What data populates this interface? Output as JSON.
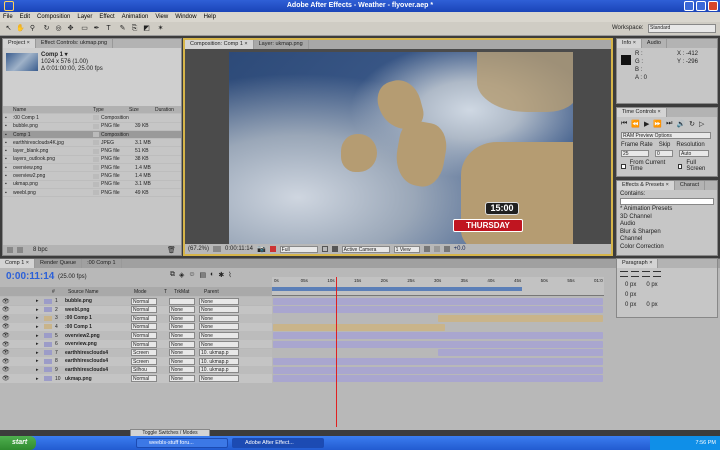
{
  "window": {
    "title": "Adobe After Effects - Weather - flyover.aep *"
  },
  "menu": [
    "File",
    "Edit",
    "Composition",
    "Layer",
    "Effect",
    "Animation",
    "View",
    "Window",
    "Help"
  ],
  "workspace": {
    "label": "Workspace:",
    "value": "Standard"
  },
  "project": {
    "tabs": [
      "Project ×",
      "Effect Controls: ukmap.png"
    ],
    "info_name": "Comp 1 ▾",
    "info_size": "1024 x 576 (1.00)",
    "info_dur": "Δ 0:01:00:00, 25.00 fps",
    "columns": [
      "Name",
      "Type",
      "Size",
      "Duration"
    ],
    "items": [
      {
        "name": ":00 Comp 1",
        "type": "Composition",
        "size": ""
      },
      {
        "name": "bubble.png",
        "type": "PNG file",
        "size": "39 KB"
      },
      {
        "name": "Comp 1",
        "type": "Composition",
        "size": ""
      },
      {
        "name": "earthhiresclouds4K.jpg",
        "type": "JPEG",
        "size": "3.1 MB"
      },
      {
        "name": "layer_blank.png",
        "type": "PNG file",
        "size": "51 KB"
      },
      {
        "name": "layers_outlook.png",
        "type": "PNG file",
        "size": "38 KB"
      },
      {
        "name": "overview.png",
        "type": "PNG file",
        "size": "1.4 MB"
      },
      {
        "name": "overview2.png",
        "type": "PNG file",
        "size": "1.4 MB"
      },
      {
        "name": "ukmap.png",
        "type": "PNG file",
        "size": "3.1 MB"
      },
      {
        "name": "weebl.png",
        "type": "PNG file",
        "size": "49 KB"
      }
    ],
    "bpc": "8 bpc"
  },
  "viewer": {
    "tabs": [
      "Composition: Comp 1 ×",
      "Layer: ukmap.png"
    ],
    "time_text": "15:00",
    "day_text": "THURSDAY",
    "zoom": "(67.2%)",
    "timecode": "0:00:11:14",
    "resolution": "Full",
    "camera": "Active Camera",
    "views": "1 View",
    "offset": "+0.0"
  },
  "info": {
    "tabs": [
      "Info ×",
      "Audio"
    ],
    "r": "R :",
    "g": "G :",
    "b": "B :",
    "a": "A : 0",
    "x": "X : -412",
    "y": "Y : -296"
  },
  "time_controls": {
    "tab": "Time Controls ×",
    "ram": "RAM Preview Options",
    "frame_rate_label": "Frame Rate",
    "skip_label": "Skip",
    "res_label": "Resolution",
    "frame_rate": "25",
    "skip": "0",
    "res": "Auto",
    "from_current": "From Current Time",
    "full_screen": "Full Screen"
  },
  "effects": {
    "tabs": [
      "Effects & Presets ×",
      "Charact"
    ],
    "contains": "Contains:",
    "items": [
      "* Animation Presets",
      "3D Channel",
      "Audio",
      "Blur & Sharpen",
      "Channel",
      "Color Correction"
    ]
  },
  "paragraph": {
    "tab": "Paragraph ×",
    "px1": "0 px",
    "px2": "0 px",
    "px3": "0 px",
    "px4": "0 px",
    "px5": "0 px"
  },
  "timeline": {
    "tabs": [
      "Comp 1 ×",
      "Render Queue",
      ":00 Comp 1"
    ],
    "timecode": "0:00:11:14",
    "fps": "(25.00 fps)",
    "columns": [
      "#",
      "Source Name",
      "Mode",
      "T",
      "TrkMat",
      "Parent"
    ],
    "ruler": [
      "0s",
      "05s",
      "10s",
      "15s",
      "20s",
      "25s",
      "30s",
      "35s",
      "40s",
      "45s",
      "50s",
      "55s",
      "01:0"
    ],
    "layers": [
      {
        "num": "1",
        "name": "bubble.png",
        "mode": "Normal",
        "trk": "",
        "parent": "None",
        "start": 0.0,
        "end": 1.0,
        "color": "#a9a6cf"
      },
      {
        "num": "2",
        "name": "weebl.png",
        "mode": "Normal",
        "trk": "None",
        "parent": "None",
        "start": 0.0,
        "end": 1.0,
        "color": "#a9a6cf"
      },
      {
        "num": "3",
        "name": ":00 Comp 1",
        "mode": "Normal",
        "trk": "None",
        "parent": "None",
        "start": 0.5,
        "end": 1.0,
        "color": "#c9b48a"
      },
      {
        "num": "4",
        "name": ":00 Comp 1",
        "mode": "Normal",
        "trk": "None",
        "parent": "None",
        "start": 0.0,
        "end": 0.52,
        "color": "#c9b48a"
      },
      {
        "num": "5",
        "name": "overview2.png",
        "mode": "Normal",
        "trk": "None",
        "parent": "None",
        "start": 0.0,
        "end": 1.0,
        "color": "#a9a6cf"
      },
      {
        "num": "6",
        "name": "overview.png",
        "mode": "Normal",
        "trk": "None",
        "parent": "None",
        "start": 0.0,
        "end": 1.0,
        "color": "#a9a6cf"
      },
      {
        "num": "7",
        "name": "earthhiresclouds4",
        "mode": "Screen",
        "trk": "None",
        "parent": "10. ukmap.p",
        "start": 0.5,
        "end": 1.0,
        "color": "#a9a6cf"
      },
      {
        "num": "8",
        "name": "earthhiresclouds4",
        "mode": "Screen",
        "trk": "None",
        "parent": "10. ukmap.p",
        "start": 0.0,
        "end": 1.0,
        "color": "#a9a6cf"
      },
      {
        "num": "9",
        "name": "earthhiresclouds4",
        "mode": "Silhou",
        "trk": "None",
        "parent": "10. ukmap.p",
        "start": 0.0,
        "end": 1.0,
        "color": "#a9a6cf"
      },
      {
        "num": "10",
        "name": "ukmap.png",
        "mode": "Normal",
        "trk": "None",
        "parent": "None",
        "start": 0.0,
        "end": 1.0,
        "color": "#a9a6cf"
      }
    ],
    "playhead_fraction": 0.19,
    "toggle": "Toggle Switches / Modes"
  },
  "taskbar": {
    "start": "start",
    "tasks": [
      "weebls-stuff foru...",
      "Adobe After Effect..."
    ],
    "clock": "7:56 PM"
  }
}
